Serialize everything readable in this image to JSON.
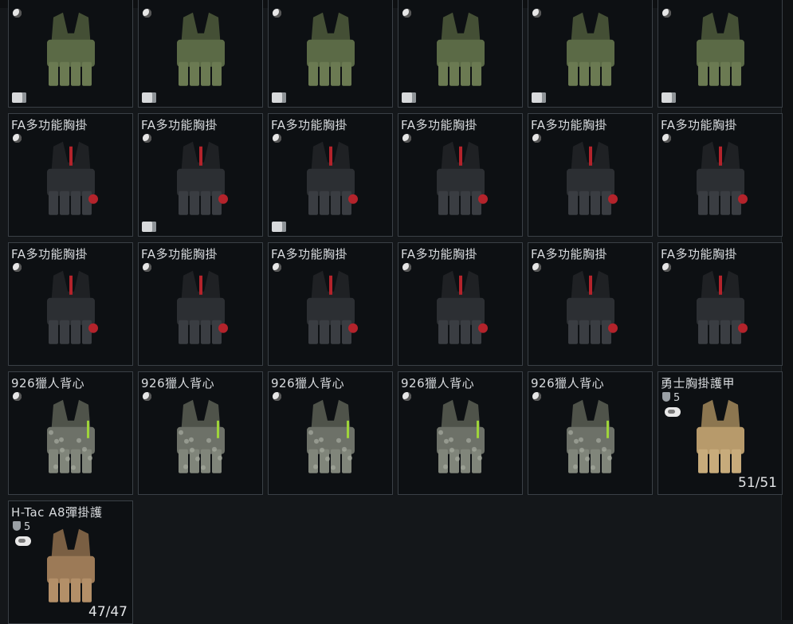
{
  "grid": {
    "items": [
      {
        "name": "",
        "kind": "olive-rig",
        "has_box_icon": true
      },
      {
        "name": "",
        "kind": "olive-rig",
        "has_box_icon": true
      },
      {
        "name": "",
        "kind": "olive-rig",
        "has_box_icon": true
      },
      {
        "name": "",
        "kind": "olive-rig",
        "has_box_icon": true
      },
      {
        "name": "",
        "kind": "olive-rig",
        "has_box_icon": true
      },
      {
        "name": "",
        "kind": "olive-rig",
        "has_box_icon": true
      },
      {
        "name": "FA多功能胸掛",
        "kind": "black-rig"
      },
      {
        "name": "FA多功能胸掛",
        "kind": "black-rig",
        "has_box_icon": true
      },
      {
        "name": "FA多功能胸掛",
        "kind": "black-rig",
        "has_box_icon": true
      },
      {
        "name": "FA多功能胸掛",
        "kind": "black-rig"
      },
      {
        "name": "FA多功能胸掛",
        "kind": "black-rig"
      },
      {
        "name": "FA多功能胸掛",
        "kind": "black-rig"
      },
      {
        "name": "FA多功能胸掛",
        "kind": "black-rig"
      },
      {
        "name": "FA多功能胸掛",
        "kind": "black-rig"
      },
      {
        "name": "FA多功能胸掛",
        "kind": "black-rig"
      },
      {
        "name": "FA多功能胸掛",
        "kind": "black-rig"
      },
      {
        "name": "FA多功能胸掛",
        "kind": "black-rig"
      },
      {
        "name": "FA多功能胸掛",
        "kind": "black-rig"
      },
      {
        "name": "926獵人背心",
        "kind": "camo-vest"
      },
      {
        "name": "926獵人背心",
        "kind": "camo-vest"
      },
      {
        "name": "926獵人背心",
        "kind": "camo-vest"
      },
      {
        "name": "926獵人背心",
        "kind": "camo-vest"
      },
      {
        "name": "926獵人背心",
        "kind": "camo-vest"
      },
      {
        "name": "勇士胸掛護甲",
        "kind": "tan-armor",
        "armor_class": "5",
        "durability": "51/51"
      },
      {
        "name": "H-Tac A8彈掛護",
        "kind": "coyote-armor",
        "armor_class": "5",
        "durability": "47/47"
      }
    ]
  },
  "colors": {
    "olive": "#5b6a46",
    "black": "#2c2f33",
    "accent_red": "#b4232b",
    "camo": "#6d7168",
    "tan": "#b79a6b",
    "coyote": "#9c7a57"
  },
  "icons": {
    "marker": "player-marker-icon",
    "box": "container-icon",
    "shield": "armor-class-icon",
    "bubble": "tag-bubble-icon"
  }
}
